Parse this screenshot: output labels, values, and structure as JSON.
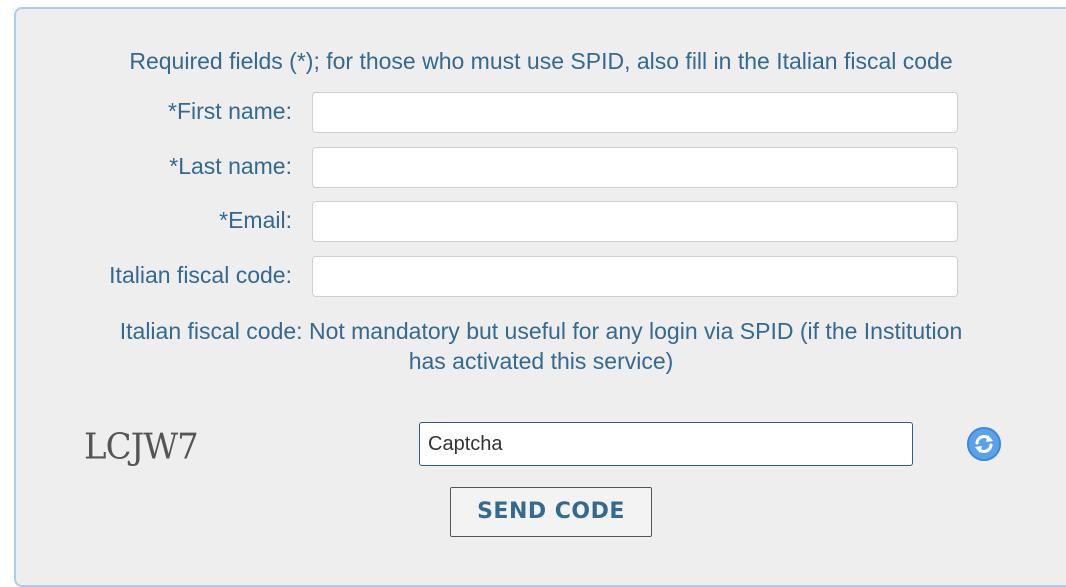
{
  "form": {
    "required_note": "Required fields (*); for those who must use SPID, also fill in the Italian fiscal code",
    "fields": [
      {
        "label": "*First name:",
        "value": ""
      },
      {
        "label": "*Last name:",
        "value": ""
      },
      {
        "label": "*Email:",
        "value": ""
      },
      {
        "label": "Italian fiscal code:",
        "value": ""
      }
    ],
    "fiscal_note_line1": "Italian fiscal code: Not mandatory but useful for any login via SPID (if the Institution",
    "fiscal_note_line2": "has activated this service)",
    "captcha": {
      "image_text": "LCJW7",
      "placeholder": "Captcha",
      "refresh_icon": "refresh-icon"
    },
    "send_label": "SEND CODE"
  },
  "colors": {
    "label_text": "#346990",
    "panel_bg": "#eeeeee",
    "panel_border": "#a9cdef",
    "refresh_blue": "#5aa2ec"
  }
}
